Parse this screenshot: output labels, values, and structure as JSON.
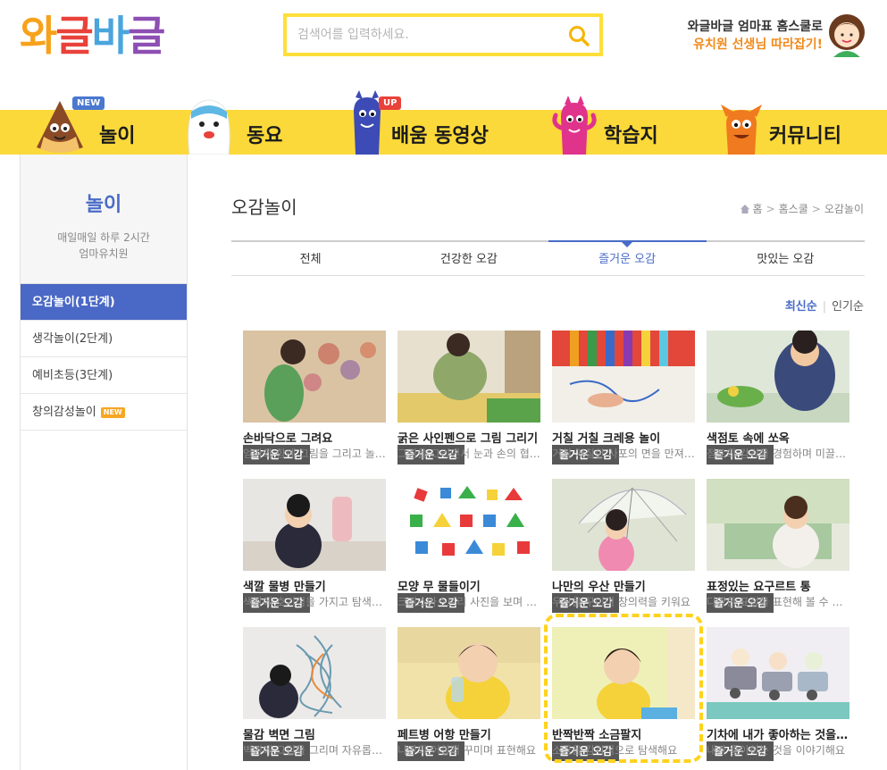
{
  "header": {
    "logo": [
      "와",
      "글",
      "바",
      "글"
    ],
    "search_placeholder": "검색어를 입력하세요.",
    "promo_line1": "와글바글 엄마표 홈스쿨로",
    "promo_line2": "유치원 선생님 따라잡기!"
  },
  "nav": [
    {
      "label": "놀이",
      "badge": "NEW"
    },
    {
      "label": "동요",
      "badge": ""
    },
    {
      "label": "배움 동영상",
      "badge": "UP"
    },
    {
      "label": "학습지",
      "badge": ""
    },
    {
      "label": "커뮤니티",
      "badge": ""
    }
  ],
  "sidebar": {
    "title": "놀이",
    "sub1": "매일매일 하루 2시간",
    "sub2": "엄마유치원",
    "items": [
      "오감놀이(1단계)",
      "생각놀이(2단계)",
      "예비초등(3단계)",
      "창의감성놀이"
    ],
    "new_tag": "NEW"
  },
  "main": {
    "title": "오감놀이",
    "breadcrumb": [
      "홈",
      "홈스쿨",
      "오감놀이"
    ],
    "tabs": [
      "전체",
      "건강한 오감",
      "즐거운 오감",
      "맛있는 오감"
    ],
    "sort_active": "최신순",
    "sort_other": "인기순"
  },
  "colors": {
    "accent": "#4a6cc7",
    "nav_yellow": "#fbd93a",
    "highlight": "#ffd21e"
  },
  "cards": [
    {
      "cat": "즐거운 오감",
      "title": "손바닥으로 그려요",
      "desc": "엄마와 함께 그림을 그리고 놀아요"
    },
    {
      "cat": "즐거운 오감",
      "title": "굵은 사인펜으로 그림 그리기",
      "desc": "그림을 그리면서 눈과 손의 협응력을"
    },
    {
      "cat": "즐거운 오감",
      "title": "거칠 거칠 크레용 놀이",
      "desc": "거칠 거칠한 사포의 면을 만져봐요"
    },
    {
      "cat": "즐거운 오감",
      "title": "색점토 속에 쏘옥",
      "desc": "점토의 감각을 경험하며 미끌미끌"
    },
    {
      "cat": "즐거운 오감",
      "title": "색깔 물병 만들기",
      "desc": "색깔에 호기심을 가지고 탐색해요"
    },
    {
      "cat": "즐거운 오감",
      "title": "모양 무 물들이기",
      "desc": "크리스마스트리 사진을 보며 만들어요"
    },
    {
      "cat": "즐거운 오감",
      "title": "나만의 우산 만들기",
      "desc": "우산을 꾸미며 창의력을 키워요"
    },
    {
      "cat": "즐거운 오감",
      "title": "표정있는 요구르트 통",
      "desc": "다양한 표정을 표현해 볼 수 있어요"
    },
    {
      "cat": "즐거운 오감",
      "title": "물감 벽면 그림",
      "desc": "벽면에 그림을 그리며 자유롭게 표현해요"
    },
    {
      "cat": "즐거운 오감",
      "title": "페트병 어항 만들기",
      "desc": "나만의 어항의 꾸미며 표현해요"
    },
    {
      "cat": "즐거운 오감",
      "title": "반짝반짝 소금팔지",
      "desc": "소금을 감각적으로 탐색해요"
    },
    {
      "cat": "즐거운 오감",
      "title": "기차에 내가 좋아하는 것을 태워요",
      "desc": "내가 좋아하는 것을 이야기해요"
    }
  ]
}
